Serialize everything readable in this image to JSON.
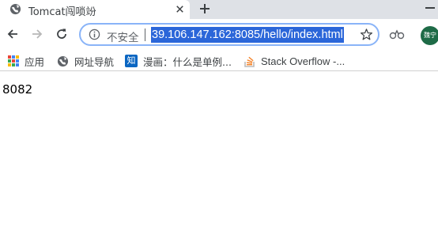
{
  "tab": {
    "title": "Tomcat闯唢竕"
  },
  "toolbar": {
    "security_label": "不安全",
    "url": "39.106.147.162:8085/hello/index.html",
    "avatar_text": "魏宁"
  },
  "bookmarks": [
    {
      "label": "应用",
      "icon": "apps-grid-icon"
    },
    {
      "label": "网址导航",
      "icon": "globe-icon"
    },
    {
      "label": "漫画：什么是单例...",
      "icon": "zhihu-icon",
      "icon_text": "知"
    },
    {
      "label": "Stack Overflow -...",
      "icon": "stackoverflow-icon"
    }
  ],
  "page": {
    "body_text": "8082"
  },
  "colors": {
    "selection": "#2b66d9",
    "focus_ring": "#8ab4f8",
    "tabstrip_bg": "#dee1e6",
    "zhihu_blue": "#0a66c2",
    "stackoverflow_orange": "#f48024",
    "avatar_bg": "#1e6b47"
  }
}
